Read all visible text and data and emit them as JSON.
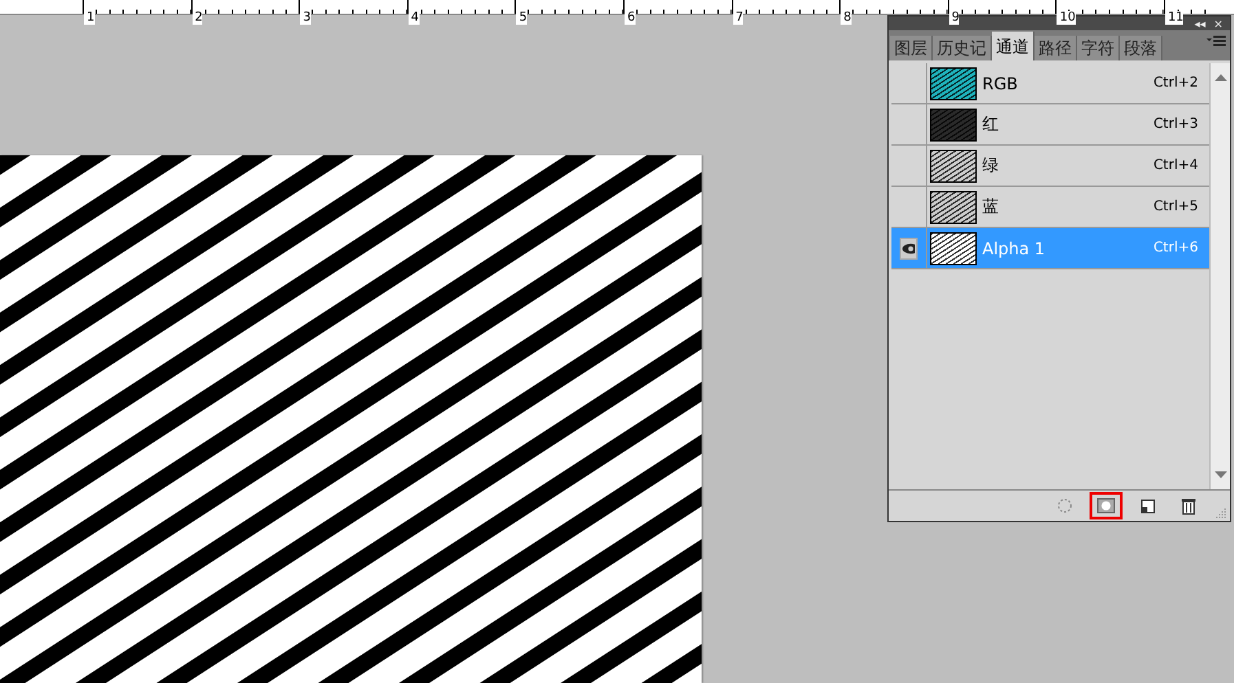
{
  "ruler": {
    "labels": [
      "1",
      "2",
      "3",
      "4",
      "5",
      "6",
      "7",
      "8",
      "9",
      "10",
      "11"
    ]
  },
  "panel": {
    "title_buttons": [
      "◂◂",
      "×"
    ],
    "tabs": [
      {
        "label": "图层",
        "selected": false
      },
      {
        "label": "历史记",
        "selected": false
      },
      {
        "label": "通道",
        "selected": true
      },
      {
        "label": "路径",
        "selected": false
      },
      {
        "label": "字符",
        "selected": false
      },
      {
        "label": "段落",
        "selected": false
      }
    ],
    "channels": [
      {
        "name": "RGB",
        "shortcut": "Ctrl+2",
        "visible": false,
        "selected": false,
        "color": "#1fb3bc"
      },
      {
        "name": "红",
        "shortcut": "Ctrl+3",
        "visible": false,
        "selected": false,
        "color": "#2a2a2a"
      },
      {
        "name": "绿",
        "shortcut": "Ctrl+4",
        "visible": false,
        "selected": false,
        "color": "#cccccc"
      },
      {
        "name": "蓝",
        "shortcut": "Ctrl+5",
        "visible": false,
        "selected": false,
        "color": "#cccccc"
      },
      {
        "name": "Alpha 1",
        "shortcut": "Ctrl+6",
        "visible": true,
        "selected": true,
        "color": "#ffffff"
      }
    ],
    "footer_buttons": [
      {
        "kind": "load-selection",
        "highlighted": false
      },
      {
        "kind": "mask",
        "highlighted": true
      },
      {
        "kind": "new",
        "highlighted": false
      },
      {
        "kind": "delete",
        "highlighted": false
      }
    ]
  }
}
